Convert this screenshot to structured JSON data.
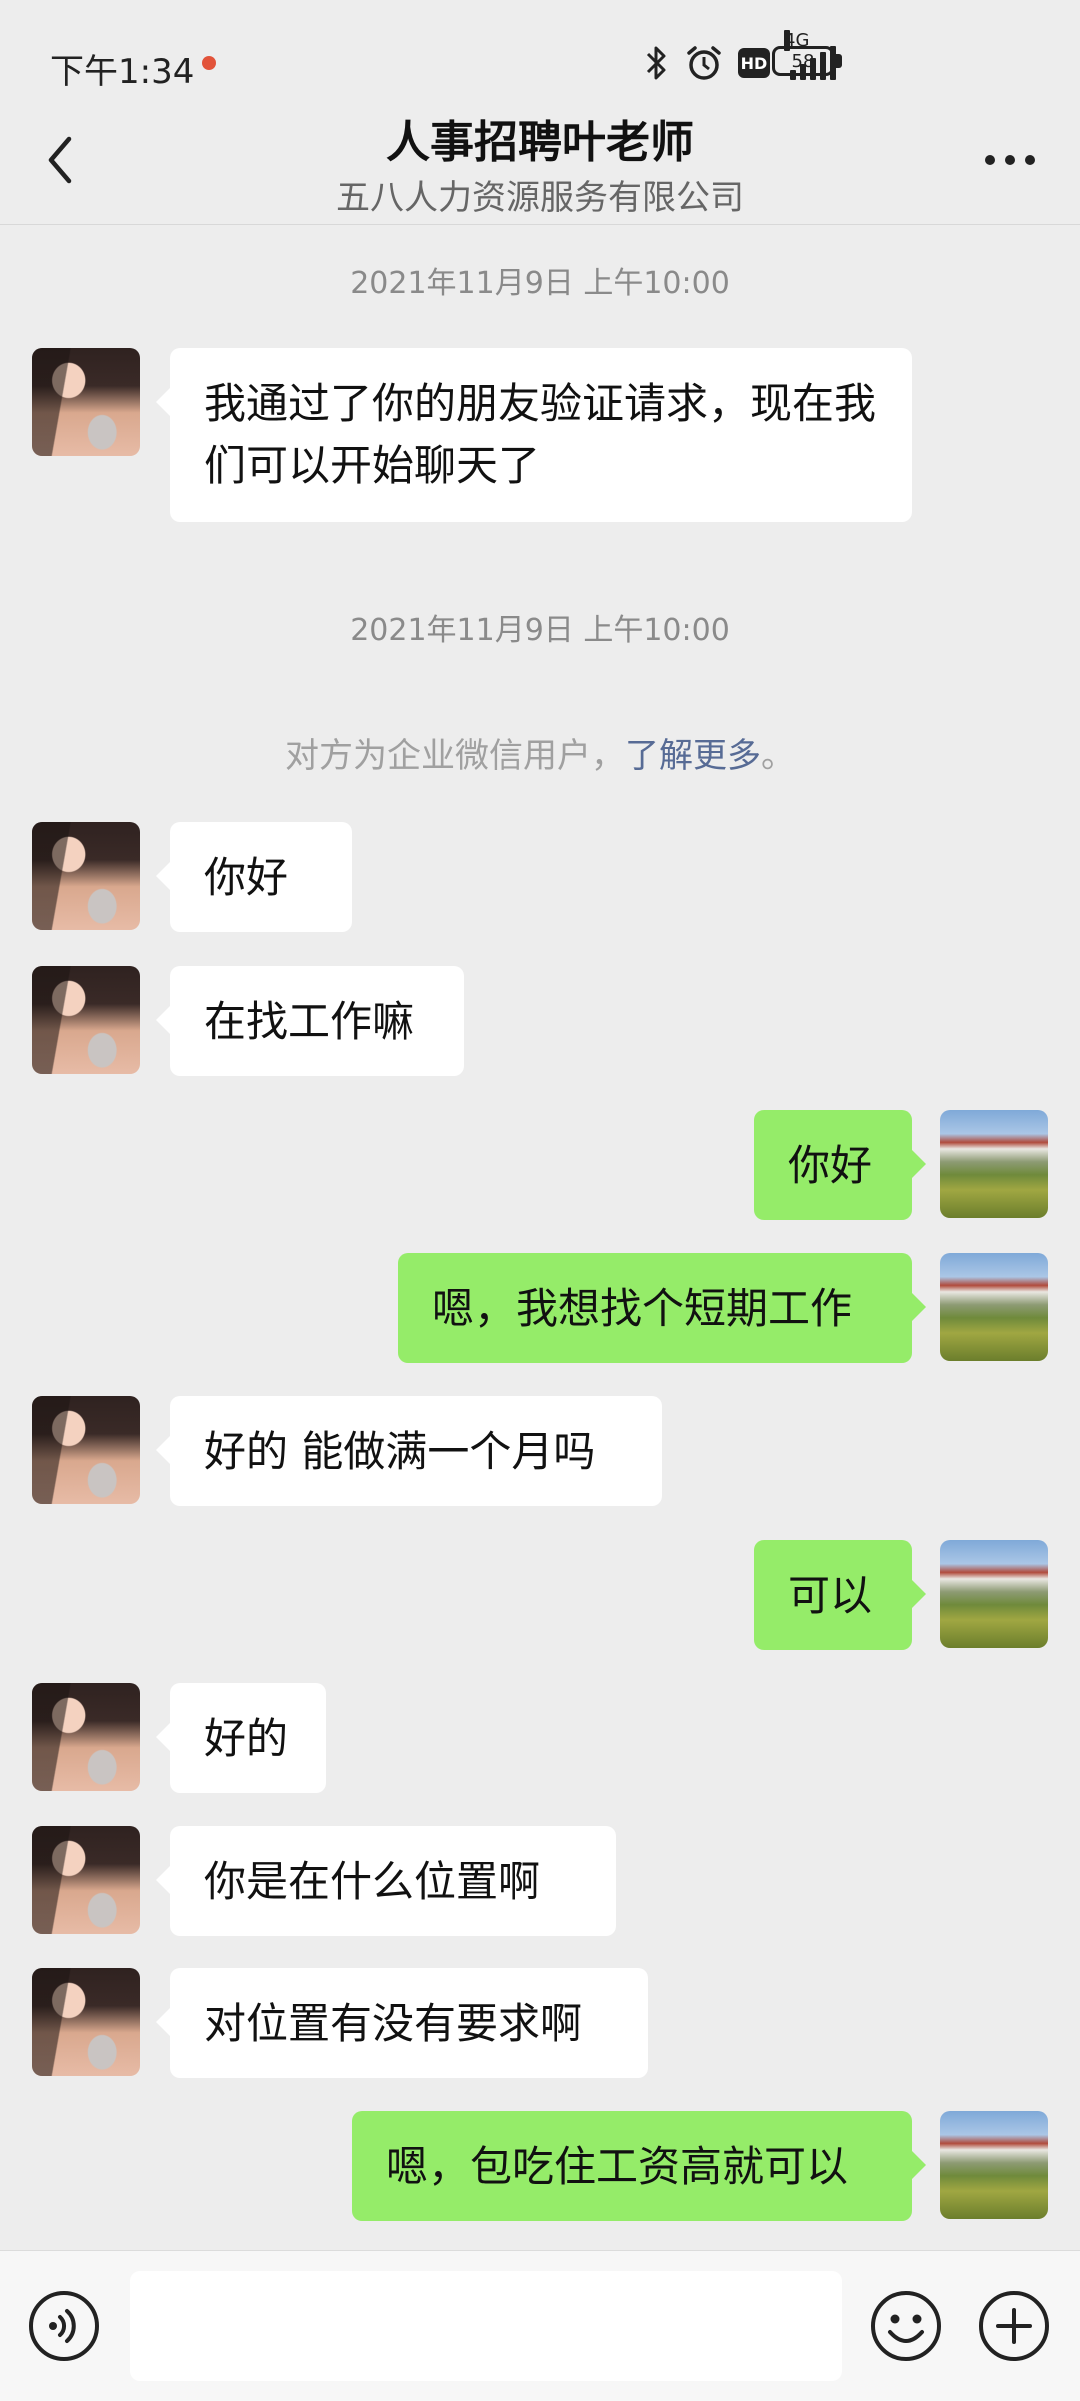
{
  "status_bar": {
    "time": "下午1:34",
    "network": "4G",
    "hd": "HD",
    "battery": "58"
  },
  "header": {
    "title": "人事招聘叶老师",
    "subtitle": "五八人力资源服务有限公司"
  },
  "chat": {
    "timestamp_1": "2021年11月9日 上午10:00",
    "timestamp_2": "2021年11月9日 上午10:00",
    "notice_text": "对方为企业微信用户，",
    "notice_link": "了解更多",
    "notice_end": "。",
    "messages": [
      {
        "from": "contact",
        "text": "我通过了你的朋友验证请求，现在我们可以开始聊天了"
      },
      {
        "from": "contact",
        "text": "你好"
      },
      {
        "from": "contact",
        "text": "在找工作嘛"
      },
      {
        "from": "me",
        "text": "你好"
      },
      {
        "from": "me",
        "text": "嗯，我想找个短期工作"
      },
      {
        "from": "contact",
        "text": "好的 能做满一个月吗"
      },
      {
        "from": "me",
        "text": "可以"
      },
      {
        "from": "contact",
        "text": "好的"
      },
      {
        "from": "contact",
        "text": "你是在什么位置啊"
      },
      {
        "from": "contact",
        "text": "对位置有没有要求啊"
      },
      {
        "from": "me",
        "text": "嗯，包吃住工资高就可以"
      }
    ]
  },
  "input_bar": {
    "value": "",
    "placeholder": ""
  },
  "colors": {
    "background": "#ededed",
    "bubble_me": "#95ec69",
    "bubble_contact": "#ffffff",
    "link": "#576b95"
  },
  "icons": {
    "back": "chevron-left-icon",
    "more": "more-icon",
    "voice": "voice-icon",
    "emoji": "emoji-icon",
    "plus": "plus-icon"
  }
}
